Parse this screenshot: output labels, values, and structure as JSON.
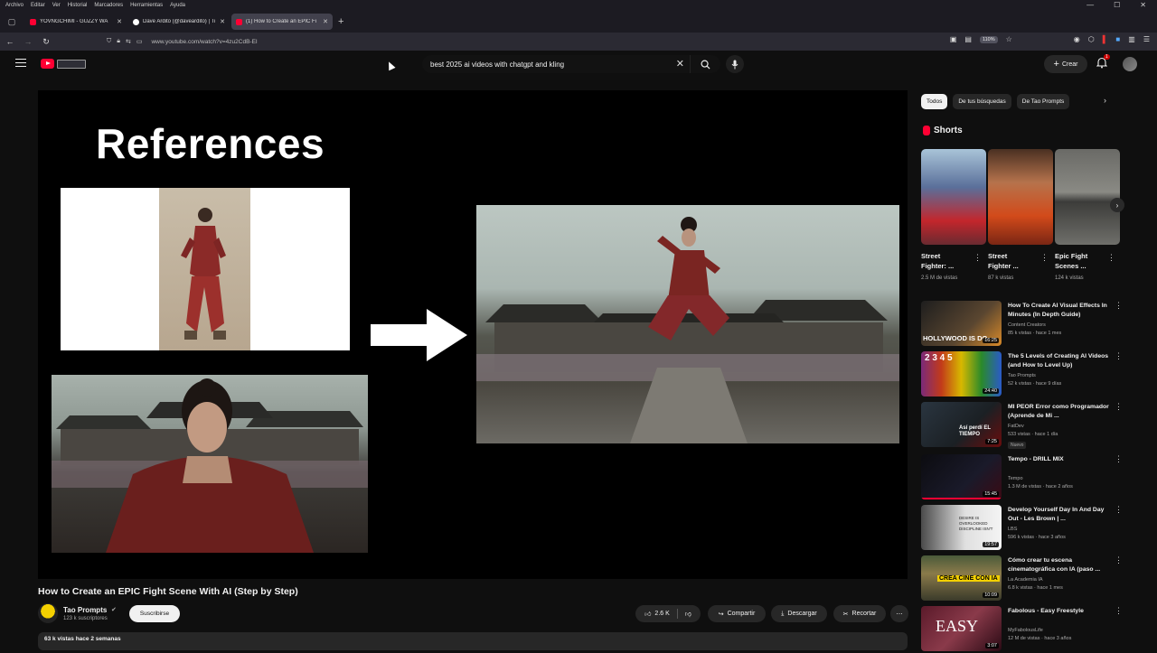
{
  "browser": {
    "menu": [
      "Archivo",
      "Editar",
      "Ver",
      "Historial",
      "Marcadores",
      "Herramientas",
      "Ayuda"
    ],
    "tabs": [
      {
        "label": "YOVNGCHIMI - GUZZY WA"
      },
      {
        "label": "Dave Ardito (@daveardito) | Ti"
      },
      {
        "label": "(1) How to Create an EPIC Fi"
      }
    ],
    "url": "www.youtube.com/watch?v=4zu2CdB-EI",
    "zoom": "110%"
  },
  "header": {
    "search_query": "best 2025 ai videos with chatgpt and kling",
    "create_label": "Crear",
    "notifications": "1"
  },
  "player": {
    "slide_title": "References"
  },
  "video": {
    "title": "How to Create an EPIC Fight Scene With AI (Step by Step)",
    "channel": "Tao Prompts",
    "subscribers": "123 k suscriptores",
    "subscribe_label": "Suscribirse",
    "likes": "2.6 K",
    "share_label": "Compartir",
    "download_label": "Descargar",
    "clip_label": "Recortar",
    "views_date": "63 k vistas  hace 2 semanas"
  },
  "sidebar": {
    "chips": [
      "Todos",
      "De tus búsquedas",
      "De Tao Prompts"
    ],
    "shorts_heading": "Shorts",
    "shorts": [
      {
        "title1": "Street",
        "title2": "Fighter: ...",
        "views": "2.5 M de vistas"
      },
      {
        "title1": "Street",
        "title2": "Fighter ...",
        "views": "87 k vistas"
      },
      {
        "title1": "Epic Fight",
        "title2": "Scenes ...",
        "views": "124 k vistas"
      }
    ],
    "recommendations": [
      {
        "title": "How To Create AI Visual Effects In Minutes (In Depth Guide)",
        "channel": "Content Creators",
        "meta": "85 k vistas · hace 1 mes",
        "duration": "16:25",
        "thumb_text": "HOLLYWOOD IS DO"
      },
      {
        "title": "The 5 Levels of Creating AI Videos (and How to Level Up)",
        "channel": "Tao Prompts",
        "meta": "52 k vistas · hace 9 días",
        "duration": "24:40",
        "thumb_text": "2 3 4 5"
      },
      {
        "title": "MI PEOR Error como Programador (Aprende de Mi ...",
        "channel": "FatDev",
        "meta": "533 vistas · hace 1 día",
        "duration": "7:25",
        "badge": "Nuevo",
        "thumb_text": "Así perdí EL TIEMPO"
      },
      {
        "title": "Tempo - DRILL MIX",
        "channel": "Tempo",
        "meta": "1.3 M de vistas · hace 2 años",
        "duration": "15:45",
        "thumb_text": ""
      },
      {
        "title": "Develop Yourself Day In And Day Out - Les Brown | ...",
        "channel": "LBS",
        "meta": "596 k vistas · hace 3 años",
        "duration": "19:57",
        "thumb_text": "DESIRE IS OVERLOOKED DISCIPLINE ISN'T"
      },
      {
        "title": "Cómo crear tu escena cinematográfica con IA (paso ...",
        "channel": "La Academia IA",
        "meta": "6.8 k vistas · hace 1 mes",
        "duration": "10:09",
        "thumb_text": "CREA CINE CON IA"
      },
      {
        "title": "Fabolous - Easy Freestyle",
        "channel": "MyFabolousLife",
        "meta": "12 M de vistas · hace 3 años",
        "duration": "3:07",
        "thumb_text": "EASY"
      }
    ]
  }
}
